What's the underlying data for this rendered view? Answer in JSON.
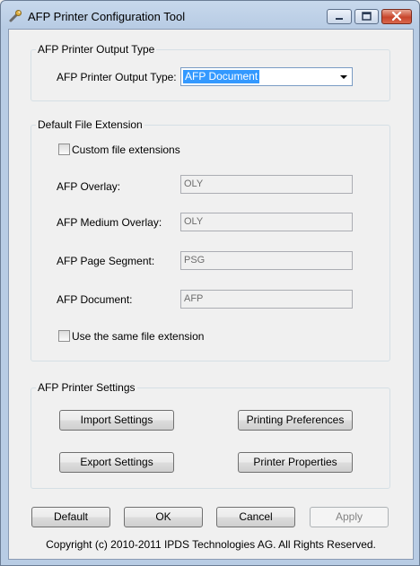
{
  "window": {
    "title": "AFP Printer Configuration Tool"
  },
  "output_type": {
    "group_label": "AFP Printer Output Type",
    "label": "AFP Printer Output Type:",
    "selected": "AFP Document"
  },
  "file_extension": {
    "group_label": "Default File Extension",
    "custom_checkbox_label": "Custom file extensions",
    "custom_checked": false,
    "overlay_label": "AFP Overlay:",
    "overlay_value": "OLY",
    "medium_overlay_label": "AFP Medium Overlay:",
    "medium_overlay_value": "OLY",
    "page_segment_label": "AFP Page Segment:",
    "page_segment_value": "PSG",
    "document_label": "AFP Document:",
    "document_value": "AFP",
    "same_ext_checkbox_label": "Use the same file extension",
    "same_ext_checked": false
  },
  "printer_settings": {
    "group_label": "AFP Printer Settings",
    "import_label": "Import Settings",
    "printing_prefs_label": "Printing Preferences",
    "export_label": "Export Settings",
    "printer_props_label": "Printer Properties"
  },
  "footer": {
    "default_label": "Default",
    "ok_label": "OK",
    "cancel_label": "Cancel",
    "apply_label": "Apply",
    "copyright": "Copyright (c) 2010-2011 IPDS Technologies AG. All Rights Reserved."
  },
  "icons": {
    "app": "wrench-icon",
    "minimize": "minimize-icon",
    "maximize": "maximize-icon",
    "close": "close-icon",
    "dropdown": "chevron-down-icon"
  },
  "colors": {
    "selection": "#3399ff",
    "close_button": "#c8452c",
    "title_bar": "#b8cce4"
  }
}
